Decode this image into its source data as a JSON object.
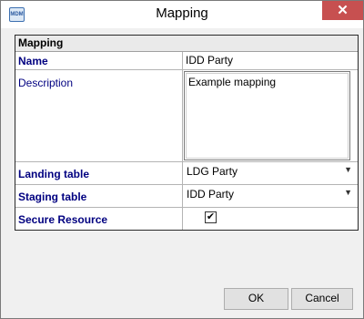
{
  "window": {
    "title": "Mapping",
    "icon_text": "MDM"
  },
  "section": {
    "title": "Mapping"
  },
  "fields": {
    "name": {
      "label": "Name",
      "value": "IDD Party"
    },
    "description": {
      "label": "Description",
      "value": "Example mapping"
    },
    "landing_table": {
      "label": "Landing table",
      "value": "LDG Party"
    },
    "staging_table": {
      "label": "Staging table",
      "value": "IDD Party"
    },
    "secure_resource": {
      "label": "Secure Resource",
      "checked": true
    }
  },
  "buttons": {
    "ok": "OK",
    "cancel": "Cancel"
  }
}
